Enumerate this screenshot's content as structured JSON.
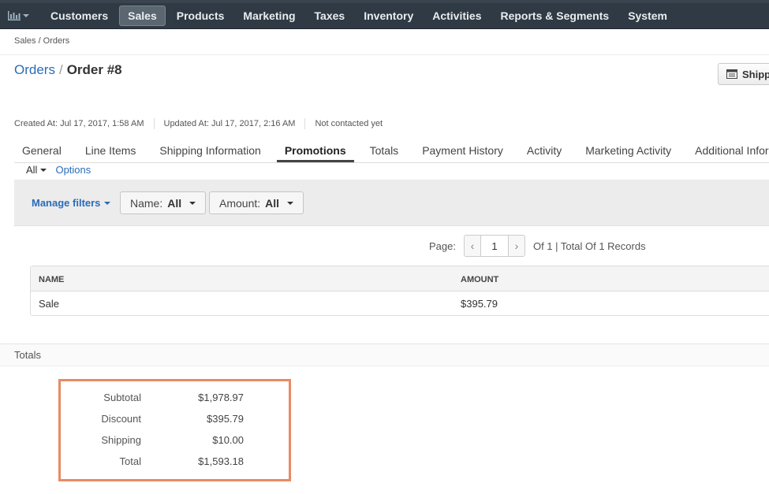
{
  "nav": {
    "items": [
      {
        "label": "Customers",
        "active": false
      },
      {
        "label": "Sales",
        "active": true
      },
      {
        "label": "Products",
        "active": false
      },
      {
        "label": "Marketing",
        "active": false
      },
      {
        "label": "Taxes",
        "active": false
      },
      {
        "label": "Inventory",
        "active": false
      },
      {
        "label": "Activities",
        "active": false
      },
      {
        "label": "Reports & Segments",
        "active": false
      },
      {
        "label": "System",
        "active": false
      }
    ]
  },
  "breadcrumb": "Sales / Orders",
  "title": {
    "parent": "Orders",
    "separator": "/",
    "current": "Order #8"
  },
  "ship_button_label": "Shipp",
  "meta": {
    "created": "Created At: Jul 17, 2017, 1:58 AM",
    "updated": "Updated At: Jul 17, 2017, 2:16 AM",
    "contacted": "Not contacted yet"
  },
  "tabs": [
    {
      "label": "General",
      "active": false
    },
    {
      "label": "Line Items",
      "active": false
    },
    {
      "label": "Shipping Information",
      "active": false
    },
    {
      "label": "Promotions",
      "active": true
    },
    {
      "label": "Totals",
      "active": false
    },
    {
      "label": "Payment History",
      "active": false
    },
    {
      "label": "Activity",
      "active": false
    },
    {
      "label": "Marketing Activity",
      "active": false
    },
    {
      "label": "Additional Information",
      "active": false
    }
  ],
  "view": {
    "all_label": "All",
    "options_label": "Options"
  },
  "filters": {
    "manage_label": "Manage filters",
    "name": {
      "label": "Name:",
      "value": "All"
    },
    "amount": {
      "label": "Amount:",
      "value": "All"
    }
  },
  "pager": {
    "label": "Page:",
    "current": "1",
    "info": "Of 1 | Total Of 1 Records"
  },
  "table": {
    "columns": [
      "NAME",
      "AMOUNT"
    ],
    "rows": [
      {
        "name": "Sale",
        "amount": "$395.79"
      }
    ]
  },
  "totals": {
    "heading": "Totals",
    "rows": [
      {
        "label": "Subtotal",
        "value": "$1,978.97"
      },
      {
        "label": "Discount",
        "value": "$395.79"
      },
      {
        "label": "Shipping",
        "value": "$10.00"
      },
      {
        "label": "Total",
        "value": "$1,593.18"
      }
    ],
    "highlight_color": "#ea8a63"
  }
}
